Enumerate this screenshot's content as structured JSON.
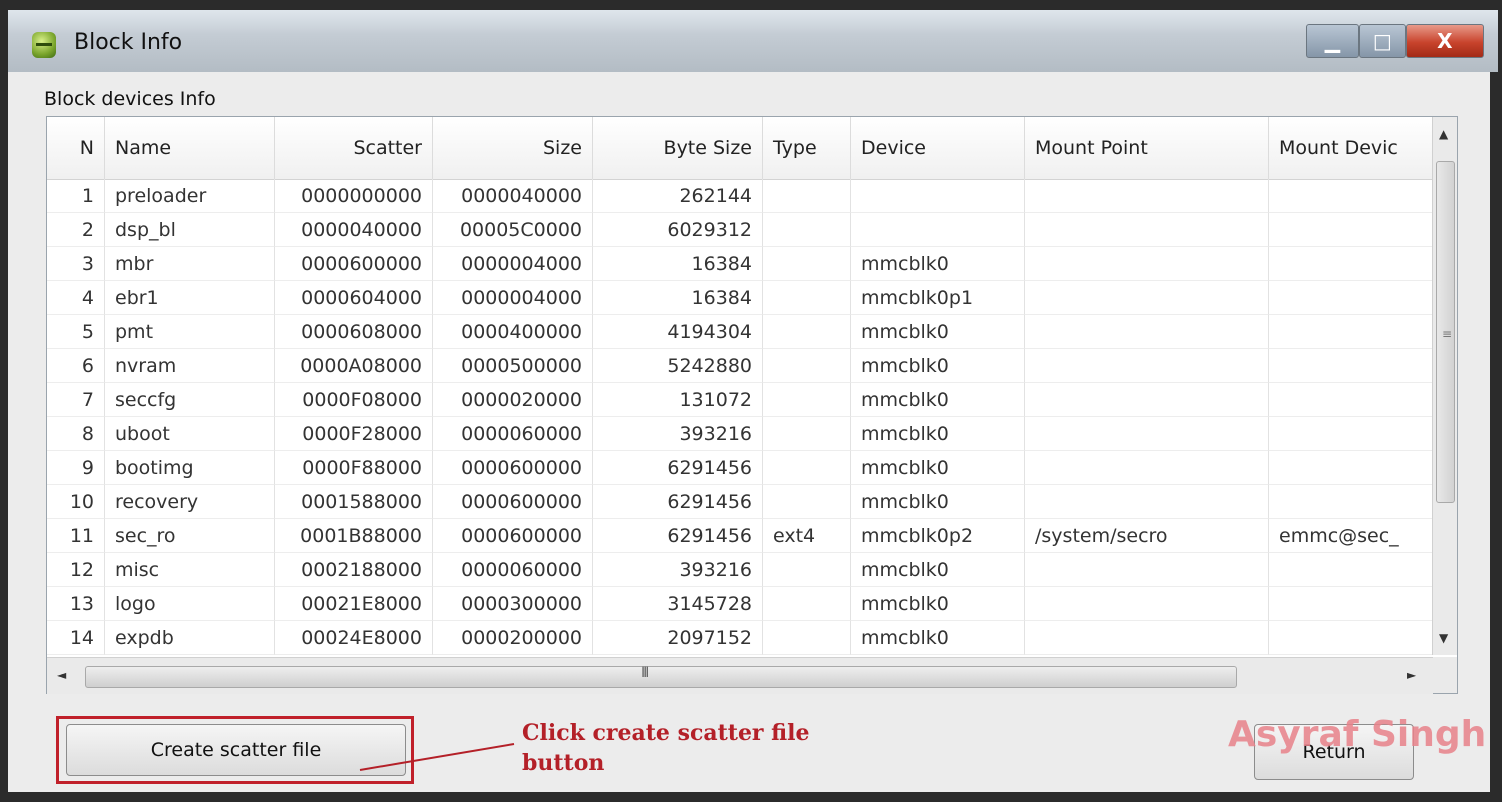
{
  "window": {
    "title": "Block Info",
    "minimize_symbol": "▁",
    "maximize_symbol": "□",
    "close_symbol": "X"
  },
  "group_label": "Block devices Info",
  "table": {
    "columns": [
      "N",
      "Name",
      "Scatter",
      "Size",
      "Byte Size",
      "Type",
      "Device",
      "Mount Point",
      "Mount Devic"
    ],
    "rows": [
      [
        "1",
        "preloader",
        "0000000000",
        "0000040000",
        "262144",
        "",
        "",
        "",
        ""
      ],
      [
        "2",
        "dsp_bl",
        "0000040000",
        "00005C0000",
        "6029312",
        "",
        "",
        "",
        ""
      ],
      [
        "3",
        "mbr",
        "0000600000",
        "0000004000",
        "16384",
        "",
        "mmcblk0",
        "",
        ""
      ],
      [
        "4",
        "ebr1",
        "0000604000",
        "0000004000",
        "16384",
        "",
        "mmcblk0p1",
        "",
        ""
      ],
      [
        "5",
        "pmt",
        "0000608000",
        "0000400000",
        "4194304",
        "",
        "mmcblk0",
        "",
        ""
      ],
      [
        "6",
        "nvram",
        "0000A08000",
        "0000500000",
        "5242880",
        "",
        "mmcblk0",
        "",
        ""
      ],
      [
        "7",
        "seccfg",
        "0000F08000",
        "0000020000",
        "131072",
        "",
        "mmcblk0",
        "",
        ""
      ],
      [
        "8",
        "uboot",
        "0000F28000",
        "0000060000",
        "393216",
        "",
        "mmcblk0",
        "",
        ""
      ],
      [
        "9",
        "bootimg",
        "0000F88000",
        "0000600000",
        "6291456",
        "",
        "mmcblk0",
        "",
        ""
      ],
      [
        "10",
        "recovery",
        "0001588000",
        "0000600000",
        "6291456",
        "",
        "mmcblk0",
        "",
        ""
      ],
      [
        "11",
        "sec_ro",
        "0001B88000",
        "0000600000",
        "6291456",
        "ext4",
        "mmcblk0p2",
        "/system/secro",
        "emmc@sec_"
      ],
      [
        "12",
        "misc",
        "0002188000",
        "0000060000",
        "393216",
        "",
        "mmcblk0",
        "",
        ""
      ],
      [
        "13",
        "logo",
        "00021E8000",
        "0000300000",
        "3145728",
        "",
        "mmcblk0",
        "",
        ""
      ],
      [
        "14",
        "expdb",
        "00024E8000",
        "0000200000",
        "2097152",
        "",
        "mmcblk0",
        "",
        ""
      ]
    ]
  },
  "scroll": {
    "up": "▲",
    "down": "▼",
    "left": "◄",
    "right": "►",
    "grip": "III"
  },
  "buttons": {
    "create_scatter": "Create scatter file",
    "return": "Return"
  },
  "annotation": {
    "line1": "Click create scatter file",
    "line2": "button"
  },
  "watermark": "Asyraf Singh",
  "colors": {
    "annotation": "#b42028",
    "watermark": "#e8828a"
  }
}
